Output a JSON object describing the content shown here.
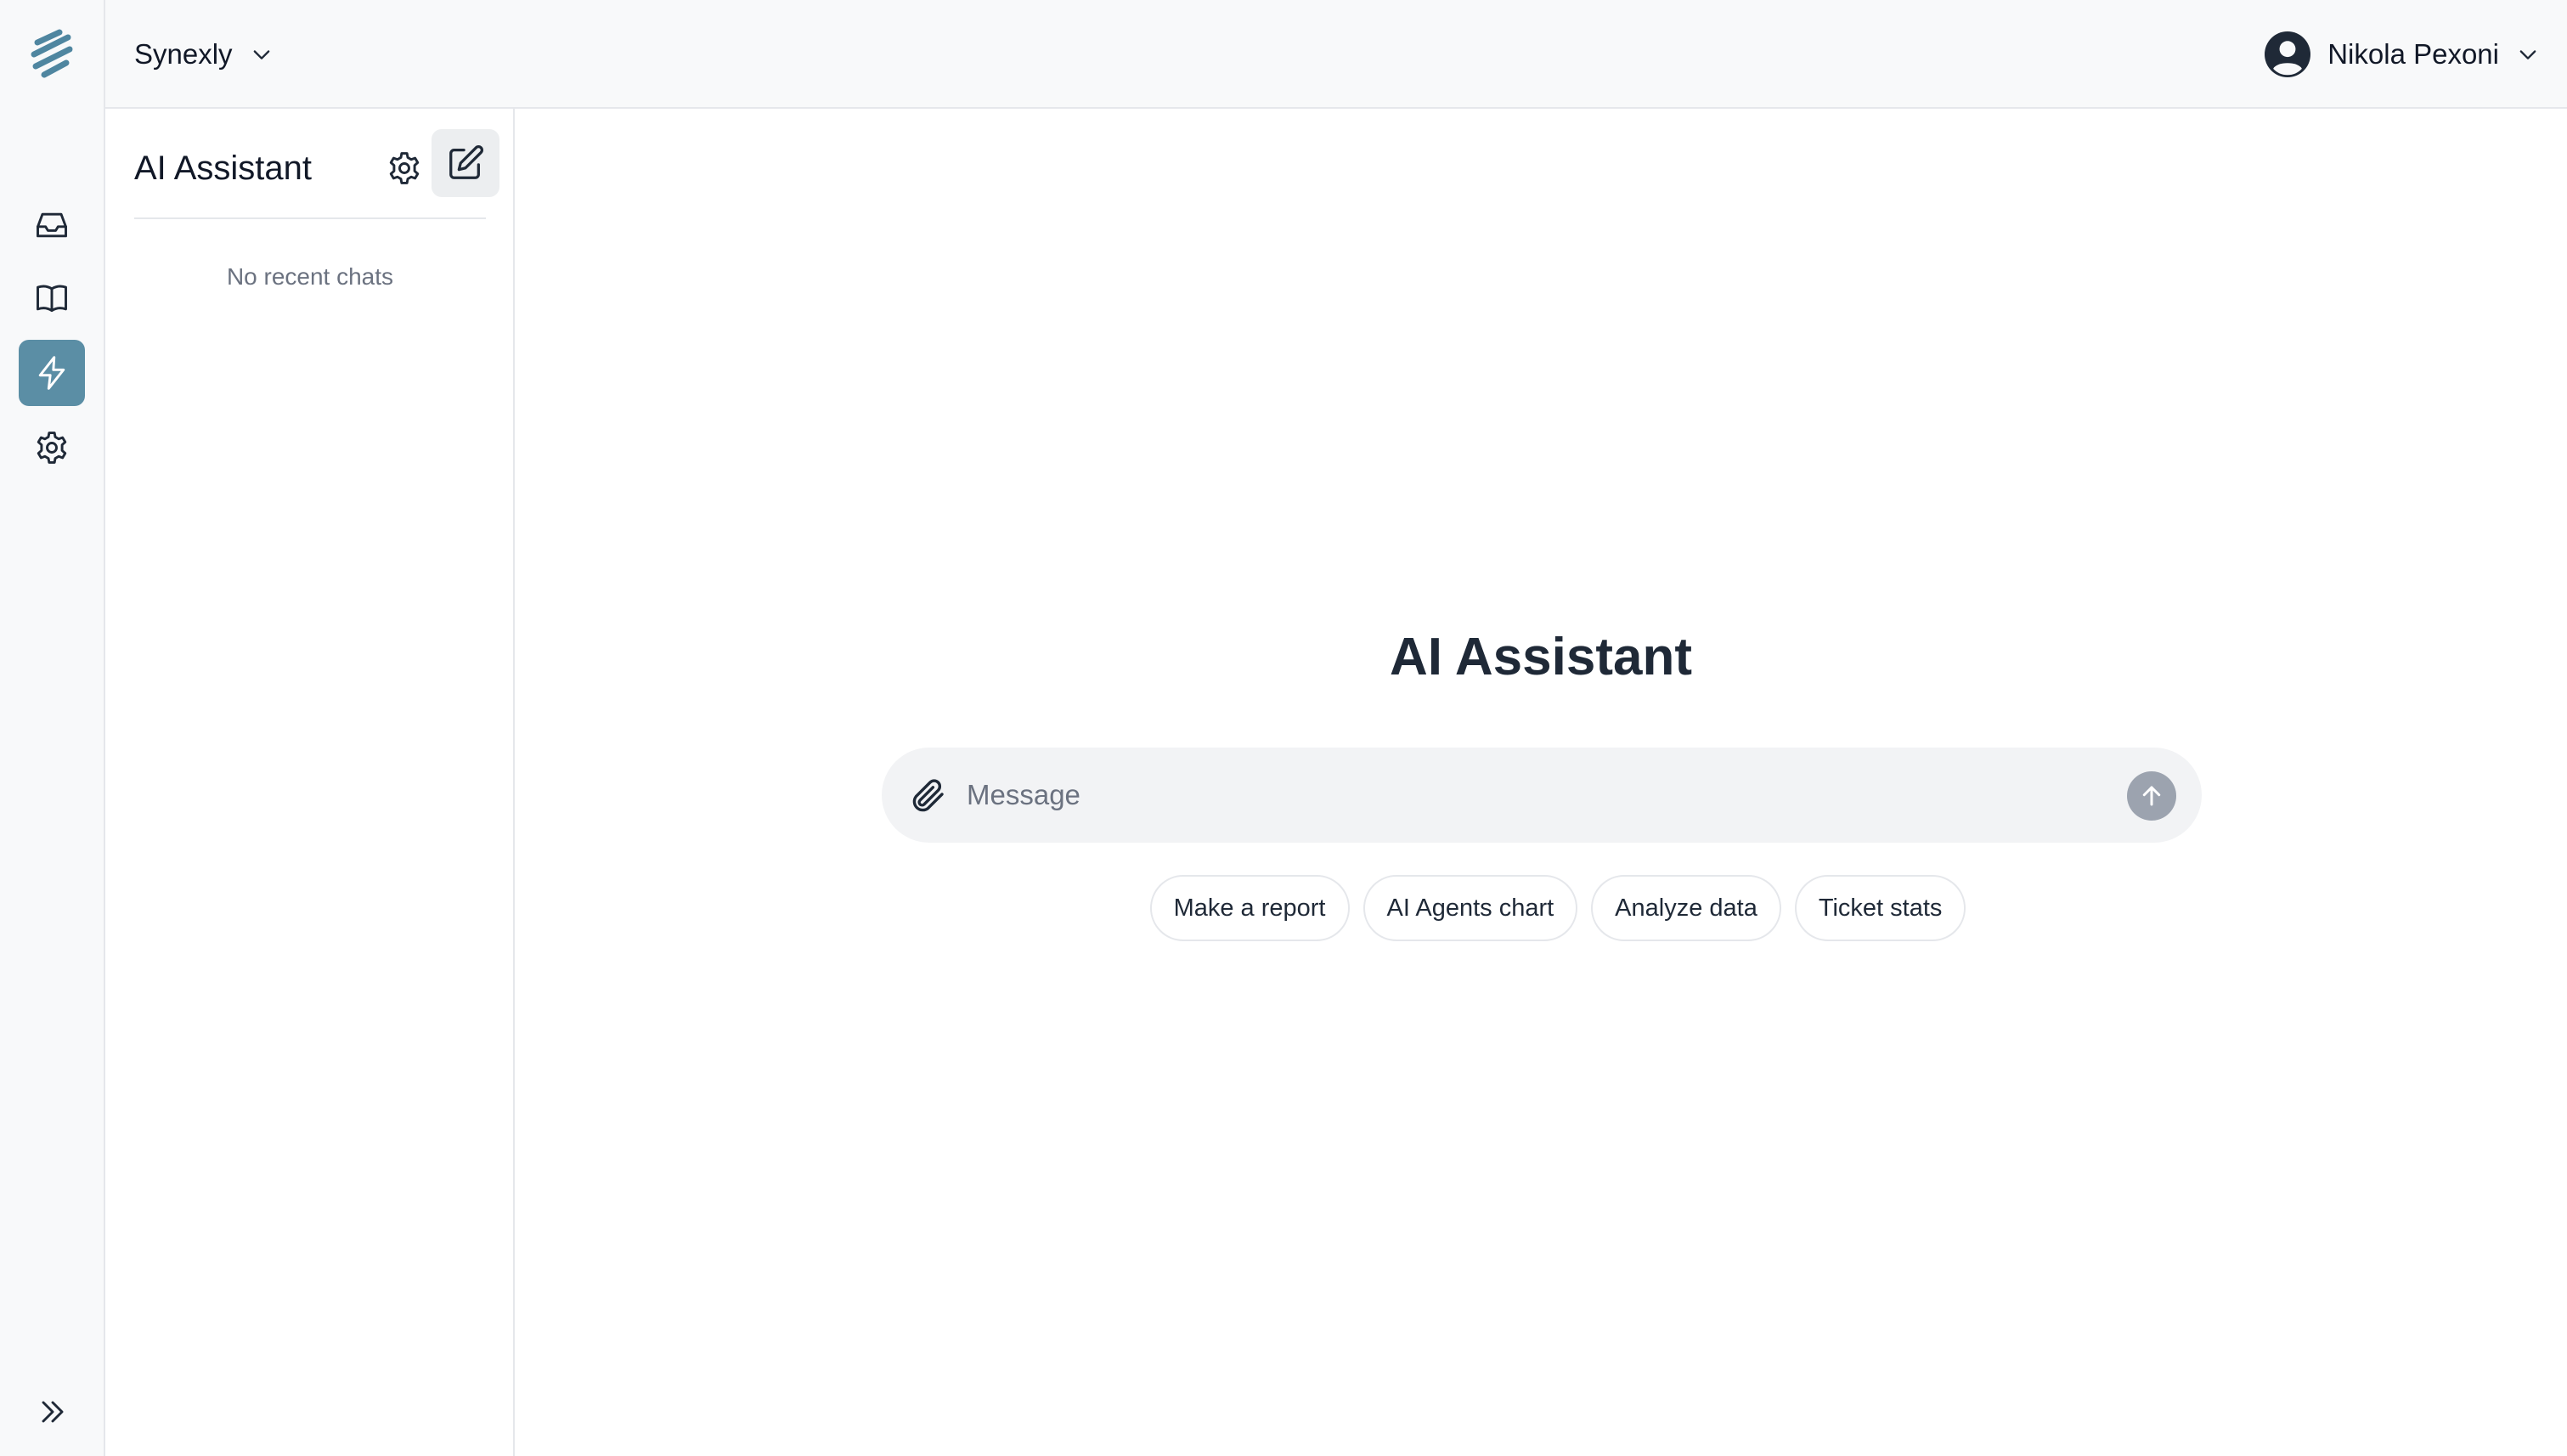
{
  "app": {
    "workspace_name": "Synexly",
    "user_name": "Nikola Pexoni",
    "accent_color": "#5b8ea5"
  },
  "rail": {
    "items": [
      {
        "icon": "inbox-icon",
        "active": false
      },
      {
        "icon": "book-open-icon",
        "active": false
      },
      {
        "icon": "lightning-icon",
        "active": true
      },
      {
        "icon": "gear-icon",
        "active": false
      }
    ],
    "expand_icon": "chevrons-right-icon"
  },
  "sidebar": {
    "title": "AI Assistant",
    "empty_text": "No recent chats"
  },
  "main": {
    "title": "AI Assistant",
    "composer": {
      "placeholder": "Message",
      "value": ""
    },
    "suggestions": [
      "Make a report",
      "AI Agents chart",
      "Analyze data",
      "Ticket stats"
    ]
  }
}
